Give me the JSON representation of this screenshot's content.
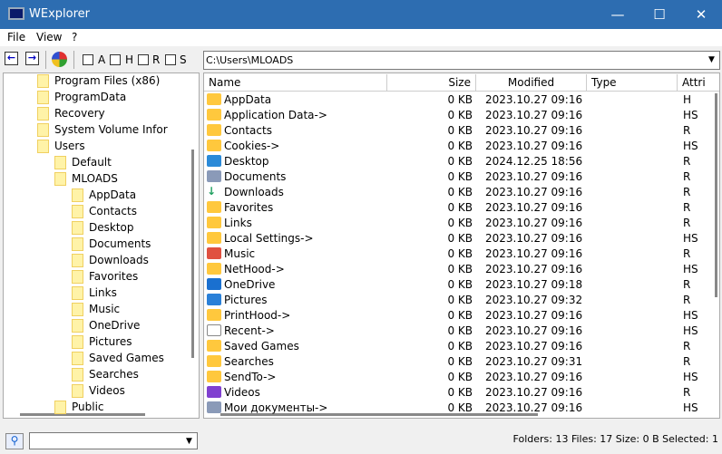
{
  "window": {
    "title": "WExplorer",
    "minimize": "—",
    "maximize": "☐",
    "close": "✕"
  },
  "menu": [
    "File",
    "View",
    "?"
  ],
  "toolbar": {
    "back": "←",
    "forward": "→",
    "filters": [
      "A",
      "H",
      "R",
      "S"
    ]
  },
  "path": "C:\\Users\\MLOADS",
  "tree": [
    {
      "label": "Program Files (x86)",
      "level": 1
    },
    {
      "label": "ProgramData",
      "level": 1
    },
    {
      "label": "Recovery",
      "level": 1
    },
    {
      "label": "System Volume Infor",
      "level": 1
    },
    {
      "label": "Users",
      "level": 1,
      "expanded": true
    },
    {
      "label": "Default",
      "level": 2
    },
    {
      "label": "MLOADS",
      "level": 2,
      "expanded": true
    },
    {
      "label": "AppData",
      "level": 3
    },
    {
      "label": "Contacts",
      "level": 3
    },
    {
      "label": "Desktop",
      "level": 3
    },
    {
      "label": "Documents",
      "level": 3
    },
    {
      "label": "Downloads",
      "level": 3
    },
    {
      "label": "Favorites",
      "level": 3
    },
    {
      "label": "Links",
      "level": 3
    },
    {
      "label": "Music",
      "level": 3
    },
    {
      "label": "OneDrive",
      "level": 3
    },
    {
      "label": "Pictures",
      "level": 3
    },
    {
      "label": "Saved Games",
      "level": 3
    },
    {
      "label": "Searches",
      "level": 3
    },
    {
      "label": "Videos",
      "level": 3
    },
    {
      "label": "Public",
      "level": 2
    }
  ],
  "columns": [
    "Name",
    "Size",
    "Modified",
    "Type",
    "Attri"
  ],
  "files": [
    {
      "name": "AppData",
      "size": "0 KB",
      "modified": "2023.10.27 09:16",
      "type": "",
      "attr": "H",
      "icon": "folder"
    },
    {
      "name": "Application Data->",
      "size": "0 KB",
      "modified": "2023.10.27 09:16",
      "type": "",
      "attr": "HS",
      "icon": "folder"
    },
    {
      "name": "Contacts",
      "size": "0 KB",
      "modified": "2023.10.27 09:16",
      "type": "",
      "attr": "R",
      "icon": "folder"
    },
    {
      "name": "Cookies->",
      "size": "0 KB",
      "modified": "2023.10.27 09:16",
      "type": "",
      "attr": "HS",
      "icon": "folder"
    },
    {
      "name": "Desktop",
      "size": "0 KB",
      "modified": "2024.12.25 18:56",
      "type": "",
      "attr": "R",
      "icon": "desktop"
    },
    {
      "name": "Documents",
      "size": "0 KB",
      "modified": "2023.10.27 09:16",
      "type": "",
      "attr": "R",
      "icon": "documents"
    },
    {
      "name": "Downloads",
      "size": "0 KB",
      "modified": "2023.10.27 09:16",
      "type": "",
      "attr": "R",
      "icon": "downloads"
    },
    {
      "name": "Favorites",
      "size": "0 KB",
      "modified": "2023.10.27 09:16",
      "type": "",
      "attr": "R",
      "icon": "folder"
    },
    {
      "name": "Links",
      "size": "0 KB",
      "modified": "2023.10.27 09:16",
      "type": "",
      "attr": "R",
      "icon": "folder"
    },
    {
      "name": "Local Settings->",
      "size": "0 KB",
      "modified": "2023.10.27 09:16",
      "type": "",
      "attr": "HS",
      "icon": "folder"
    },
    {
      "name": "Music",
      "size": "0 KB",
      "modified": "2023.10.27 09:16",
      "type": "",
      "attr": "R",
      "icon": "music"
    },
    {
      "name": "NetHood->",
      "size": "0 KB",
      "modified": "2023.10.27 09:16",
      "type": "",
      "attr": "HS",
      "icon": "folder"
    },
    {
      "name": "OneDrive",
      "size": "0 KB",
      "modified": "2023.10.27 09:18",
      "type": "",
      "attr": "R",
      "icon": "cloud"
    },
    {
      "name": "Pictures",
      "size": "0 KB",
      "modified": "2023.10.27 09:32",
      "type": "",
      "attr": "R",
      "icon": "pictures"
    },
    {
      "name": "PrintHood->",
      "size": "0 KB",
      "modified": "2023.10.27 09:16",
      "type": "",
      "attr": "HS",
      "icon": "folder"
    },
    {
      "name": "Recent->",
      "size": "0 KB",
      "modified": "2023.10.27 09:16",
      "type": "",
      "attr": "HS",
      "icon": "recent"
    },
    {
      "name": "Saved Games",
      "size": "0 KB",
      "modified": "2023.10.27 09:16",
      "type": "",
      "attr": "R",
      "icon": "folder"
    },
    {
      "name": "Searches",
      "size": "0 KB",
      "modified": "2023.10.27 09:31",
      "type": "",
      "attr": "R",
      "icon": "folder"
    },
    {
      "name": "SendTo->",
      "size": "0 KB",
      "modified": "2023.10.27 09:16",
      "type": "",
      "attr": "HS",
      "icon": "folder"
    },
    {
      "name": "Videos",
      "size": "0 KB",
      "modified": "2023.10.27 09:16",
      "type": "",
      "attr": "R",
      "icon": "videos"
    },
    {
      "name": "Мои документы->",
      "size": "0 KB",
      "modified": "2023.10.27 09:16",
      "type": "",
      "attr": "HS",
      "icon": "documents"
    }
  ],
  "status": "Folders: 13  Files: 17  Size: 0 B  Selected: 1",
  "search": {
    "value": "",
    "icon": "search-icon"
  },
  "colors": {
    "titlebar": "#2d6db1",
    "folder": "#ffc83d"
  }
}
